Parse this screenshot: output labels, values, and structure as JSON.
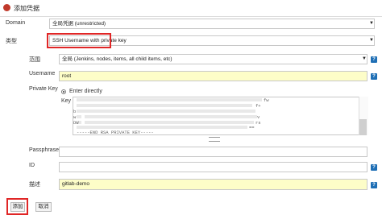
{
  "dialog": {
    "title": "添加凭据"
  },
  "form": {
    "domain": {
      "label": "Domain",
      "value": "全局凭据 (unrestricted)"
    },
    "kind": {
      "label": "类型",
      "value": "SSH Username with private key"
    },
    "scope": {
      "label": "范围",
      "value": "全局 (Jenkins, nodes, items, all child items, etc)"
    },
    "username": {
      "label": "Username",
      "value": "root"
    },
    "private_key": {
      "label": "Private Key",
      "option": "Enter directly",
      "key_label": "Key",
      "lines": [
        "fw",
        "f+",
        "b",
        "w",
        "v",
        "DW",
        "rs",
        "==",
        "-----END RSA PRIVATE KEY-----"
      ]
    },
    "passphrase": {
      "label": "Passphrase",
      "value": ""
    },
    "id": {
      "label": "ID",
      "value": ""
    },
    "description": {
      "label": "描述",
      "value": "gitlab-demo"
    }
  },
  "buttons": {
    "add": "添加",
    "cancel": "取消"
  },
  "help_glyph": "?"
}
